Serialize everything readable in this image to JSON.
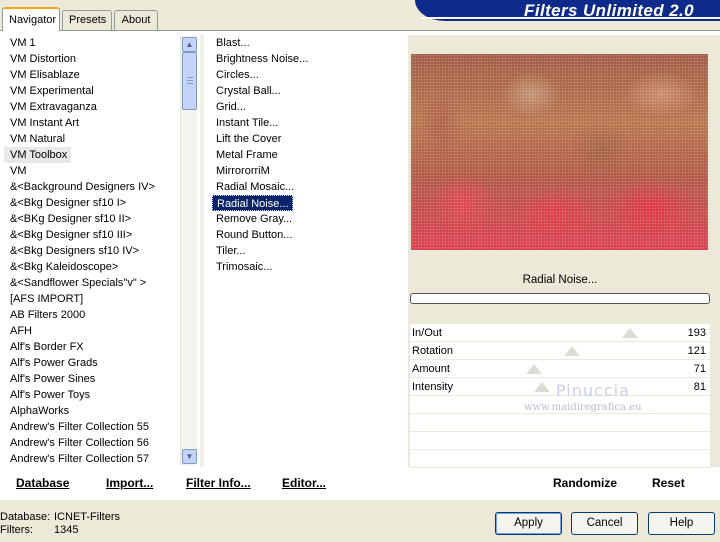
{
  "tabs": [
    {
      "label": "Navigator",
      "active": true
    },
    {
      "label": "Presets",
      "active": false
    },
    {
      "label": "About",
      "active": false
    }
  ],
  "title": "Filters Unlimited 2.0",
  "categories": [
    "VM 1",
    "VM Distortion",
    "VM Elisablaze",
    "VM Experimental",
    "VM Extravaganza",
    "VM Instant Art",
    "VM Natural",
    "VM Toolbox",
    "VM",
    "&<Background Designers IV>",
    "&<Bkg Designer sf10 I>",
    "&<BKg Designer sf10 II>",
    "&<Bkg Designer sf10 III>",
    "&<Bkg Designers sf10 IV>",
    "&<Bkg Kaleidoscope>",
    "&<Sandflower Specials\"v\" >",
    "[AFS IMPORT]",
    "AB Filters 2000",
    "AFH",
    "Alf's Border FX",
    "Alf's Power Grads",
    "Alf's Power Sines",
    "Alf's Power Toys",
    "AlphaWorks",
    "Andrew's Filter Collection 55",
    "Andrew's Filter Collection 56",
    "Andrew's Filter Collection 57"
  ],
  "selected_category": "VM Toolbox",
  "filters": [
    "Blast...",
    "Brightness Noise...",
    "Circles...",
    "Crystal Ball...",
    "Grid...",
    "Instant Tile...",
    "Lift the Cover",
    "Metal Frame",
    "MirrororriM",
    "Radial Mosaic...",
    "Radial Noise...",
    "Remove Gray...",
    "Round Button...",
    "Tiler...",
    "Trimosaic..."
  ],
  "selected_filter": "Radial Noise...",
  "preview": {
    "filter_name": "Radial Noise...",
    "progress_percent": 0
  },
  "sliders": [
    {
      "label": "In/Out",
      "value": "193",
      "fraction": 0.76
    },
    {
      "label": "Rotation",
      "value": "121",
      "fraction": 0.47
    },
    {
      "label": "Amount",
      "value": "71",
      "fraction": 0.28
    },
    {
      "label": "Intensity",
      "value": "81",
      "fraction": 0.32
    }
  ],
  "watermark": {
    "name": "Pinuccia",
    "site": "www.maidiregrafica.eu"
  },
  "toolbar": {
    "database": "Database",
    "import": "Import...",
    "filter_info": "Filter Info...",
    "editor": "Editor...",
    "randomize": "Randomize",
    "reset": "Reset"
  },
  "status": {
    "database_label": "Database:",
    "database_value": "ICNET-Filters",
    "filters_label": "Filters:",
    "filters_value": "1345"
  },
  "buttons": {
    "apply": "Apply",
    "cancel": "Cancel",
    "help": "Help"
  }
}
